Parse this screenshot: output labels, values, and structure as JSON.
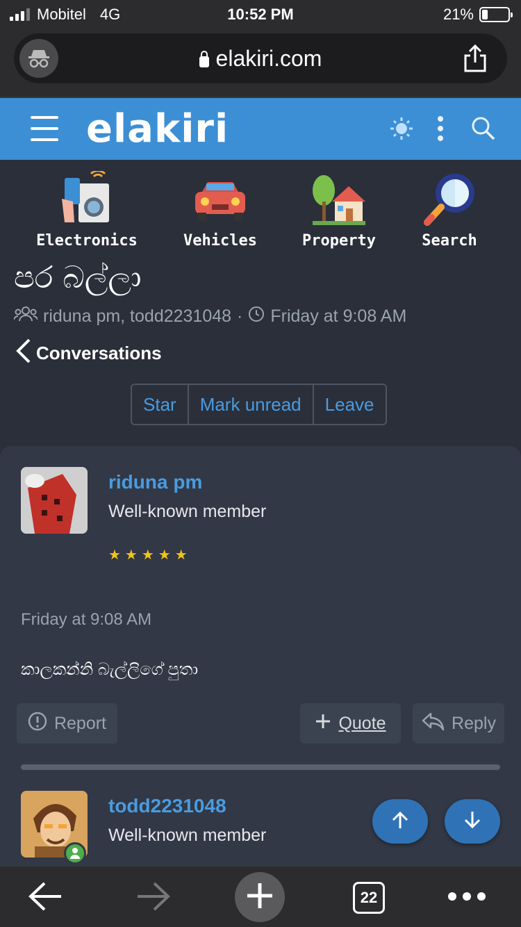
{
  "status": {
    "carrier": "Mobitel",
    "network": "4G",
    "time": "10:52 PM",
    "battery": "21%",
    "battery_level": 0.21
  },
  "browser": {
    "url": "elakiri.com",
    "tabs_count": "22"
  },
  "header": {
    "logo": "elakiri"
  },
  "categories": [
    {
      "label": "Electronics",
      "icon": "electronics-icon"
    },
    {
      "label": "Vehicles",
      "icon": "car-icon"
    },
    {
      "label": "Property",
      "icon": "house-icon"
    },
    {
      "label": "Search",
      "icon": "magnifier-icon"
    }
  ],
  "conversation": {
    "title": "පර බල්ලා",
    "participants": "riduna pm, todd2231048",
    "separator": "·",
    "date": "Friday at 9:08 AM",
    "back_label": "Conversations",
    "actions": {
      "star": "Star",
      "mark_unread": "Mark unread",
      "leave": "Leave"
    }
  },
  "messages": [
    {
      "username": "riduna pm",
      "user_title": "Well-known member",
      "rating": 5,
      "date": "Friday at 9:08 AM",
      "body": "කාලකන්නි බැල්ලිගේ පුතා",
      "actions": {
        "report": "Report",
        "quote": "Quote",
        "reply": "Reply"
      }
    },
    {
      "username": "todd2231048",
      "user_title": "Well-known member"
    }
  ],
  "colors": {
    "header": "#3c8fd4",
    "link": "#4a9be0",
    "background": "#2a2f3a",
    "card": "#323845",
    "stars": "#f0c419"
  }
}
